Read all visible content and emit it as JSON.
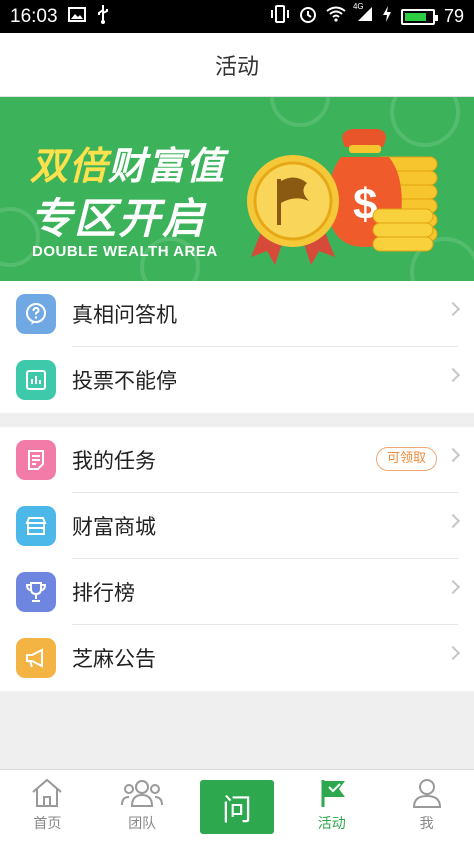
{
  "status_bar": {
    "time": "16:03",
    "battery": "79",
    "network": "4G",
    "battery_level": 0.79
  },
  "header": {
    "title": "活动"
  },
  "banner": {
    "line1_highlight": "双倍",
    "line1_rest": "财富值",
    "line2": "专区开启",
    "subtitle": "DOUBLE WEALTH AREA"
  },
  "group1": [
    {
      "label": "真相问答机",
      "icon": "question-bubble-icon",
      "color": "#6fa8e3"
    },
    {
      "label": "投票不能停",
      "icon": "bar-chart-icon",
      "color": "#3ec9ab"
    }
  ],
  "group2": [
    {
      "label": "我的任务",
      "icon": "task-list-icon",
      "color": "#f27ba8",
      "badge": "可领取"
    },
    {
      "label": "财富商城",
      "icon": "shop-icon",
      "color": "#4cb8ea"
    },
    {
      "label": "排行榜",
      "icon": "trophy-icon",
      "color": "#6f86e0"
    },
    {
      "label": "芝麻公告",
      "icon": "megaphone-icon",
      "color": "#f4b443"
    }
  ],
  "tabs": [
    {
      "label": "首页",
      "icon": "home-icon",
      "active": false
    },
    {
      "label": "团队",
      "icon": "team-icon",
      "active": false
    },
    {
      "label": "问",
      "icon": "ask-button",
      "active": false
    },
    {
      "label": "活动",
      "icon": "flag-icon",
      "active": true
    },
    {
      "label": "我",
      "icon": "user-icon",
      "active": false
    }
  ],
  "colors": {
    "primary": "#2ea84e",
    "banner_bg": "#3cb35a",
    "highlight": "#ffe14d"
  }
}
